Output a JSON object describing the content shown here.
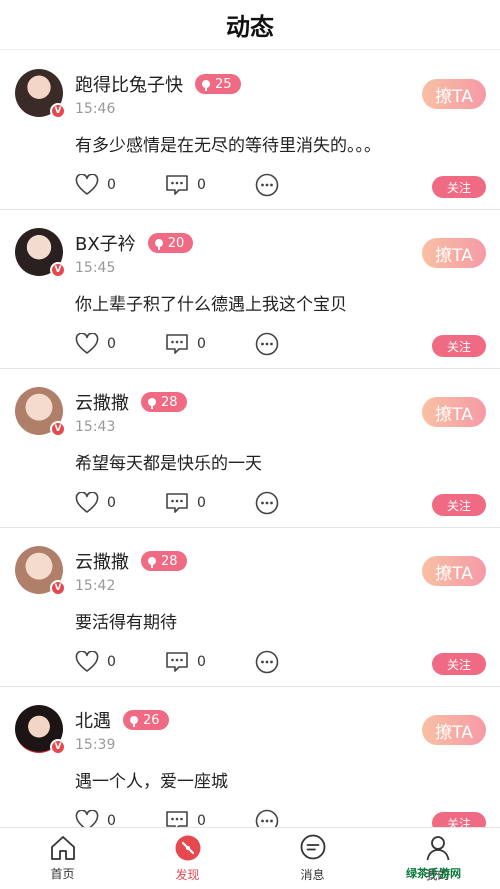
{
  "header": {
    "title": "动态"
  },
  "posts": [
    {
      "name": "跑得比兔子快",
      "level": "25",
      "time": "15:46",
      "content": "有多少感情是在无尽的等待里消失的。。。",
      "likes": "0",
      "comments": "0"
    },
    {
      "name": "BX子衿",
      "level": "20",
      "time": "15:45",
      "content": "你上辈子积了什么德遇上我这个宝贝",
      "likes": "0",
      "comments": "0"
    },
    {
      "name": "云撒撒",
      "level": "28",
      "time": "15:43",
      "content": "希望每天都是快乐的一天",
      "likes": "0",
      "comments": "0"
    },
    {
      "name": "云撒撒",
      "level": "28",
      "time": "15:42",
      "content": "要活得有期待",
      "likes": "0",
      "comments": "0"
    },
    {
      "name": "北遇",
      "level": "26",
      "time": "15:39",
      "content": "遇一个人，爱一座城",
      "likes": "0",
      "comments": "0"
    }
  ],
  "labels": {
    "liao": "撩TA",
    "follow": "关注",
    "verified": "V"
  },
  "tabs": [
    "首页",
    "发现",
    "消息",
    "我的"
  ],
  "watermark": "绿茶手游网",
  "colors": {
    "accent": "#f06a84",
    "active": "#e5484d"
  }
}
